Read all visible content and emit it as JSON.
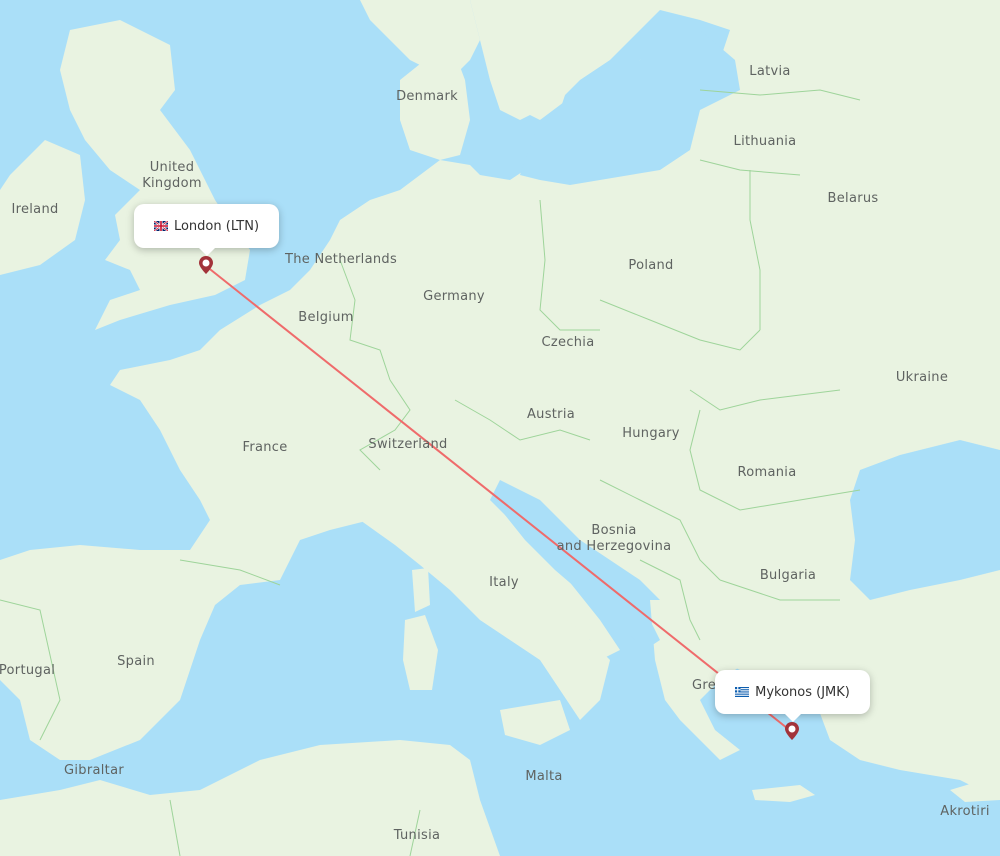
{
  "map": {
    "colors": {
      "water": "#aadff8",
      "land": "#e9f3e1",
      "border": "#9ed49a",
      "route": "#ef6b6b",
      "pin": "#a2333a",
      "label": "#5f6361"
    },
    "route": {
      "origin": {
        "city": "London",
        "code": "LTN",
        "label": "London (LTN)",
        "flag": "uk-flag"
      },
      "destination": {
        "city": "Mykonos",
        "code": "JMK",
        "label": "Mykonos (JMK)",
        "flag": "greece-flag"
      }
    },
    "country_labels": [
      {
        "id": "latvia",
        "text": "Latvia"
      },
      {
        "id": "denmark",
        "text": "Denmark"
      },
      {
        "id": "lithuania",
        "text": "Lithuania"
      },
      {
        "id": "united-kingdom",
        "text": "United\nKingdom"
      },
      {
        "id": "belarus",
        "text": "Belarus"
      },
      {
        "id": "ireland",
        "text": "Ireland"
      },
      {
        "id": "netherlands",
        "text": "The Netherlands"
      },
      {
        "id": "poland",
        "text": "Poland"
      },
      {
        "id": "germany",
        "text": "Germany"
      },
      {
        "id": "belgium",
        "text": "Belgium"
      },
      {
        "id": "czechia",
        "text": "Czechia"
      },
      {
        "id": "ukraine",
        "text": "Ukraine"
      },
      {
        "id": "austria",
        "text": "Austria"
      },
      {
        "id": "hungary",
        "text": "Hungary"
      },
      {
        "id": "switzerland",
        "text": "Switzerland"
      },
      {
        "id": "france",
        "text": "France"
      },
      {
        "id": "romania",
        "text": "Romania"
      },
      {
        "id": "bosnia",
        "text": "Bosnia\nand Herzegovina"
      },
      {
        "id": "bulgaria",
        "text": "Bulgaria"
      },
      {
        "id": "italy",
        "text": "Italy"
      },
      {
        "id": "spain",
        "text": "Spain"
      },
      {
        "id": "portugal",
        "text": "Portugal"
      },
      {
        "id": "greece",
        "text": "Gre"
      },
      {
        "id": "gibraltar",
        "text": "Gibraltar"
      },
      {
        "id": "malta",
        "text": "Malta"
      },
      {
        "id": "tunisia",
        "text": "Tunisia"
      },
      {
        "id": "akrotiri",
        "text": "Akrotiri"
      }
    ]
  }
}
